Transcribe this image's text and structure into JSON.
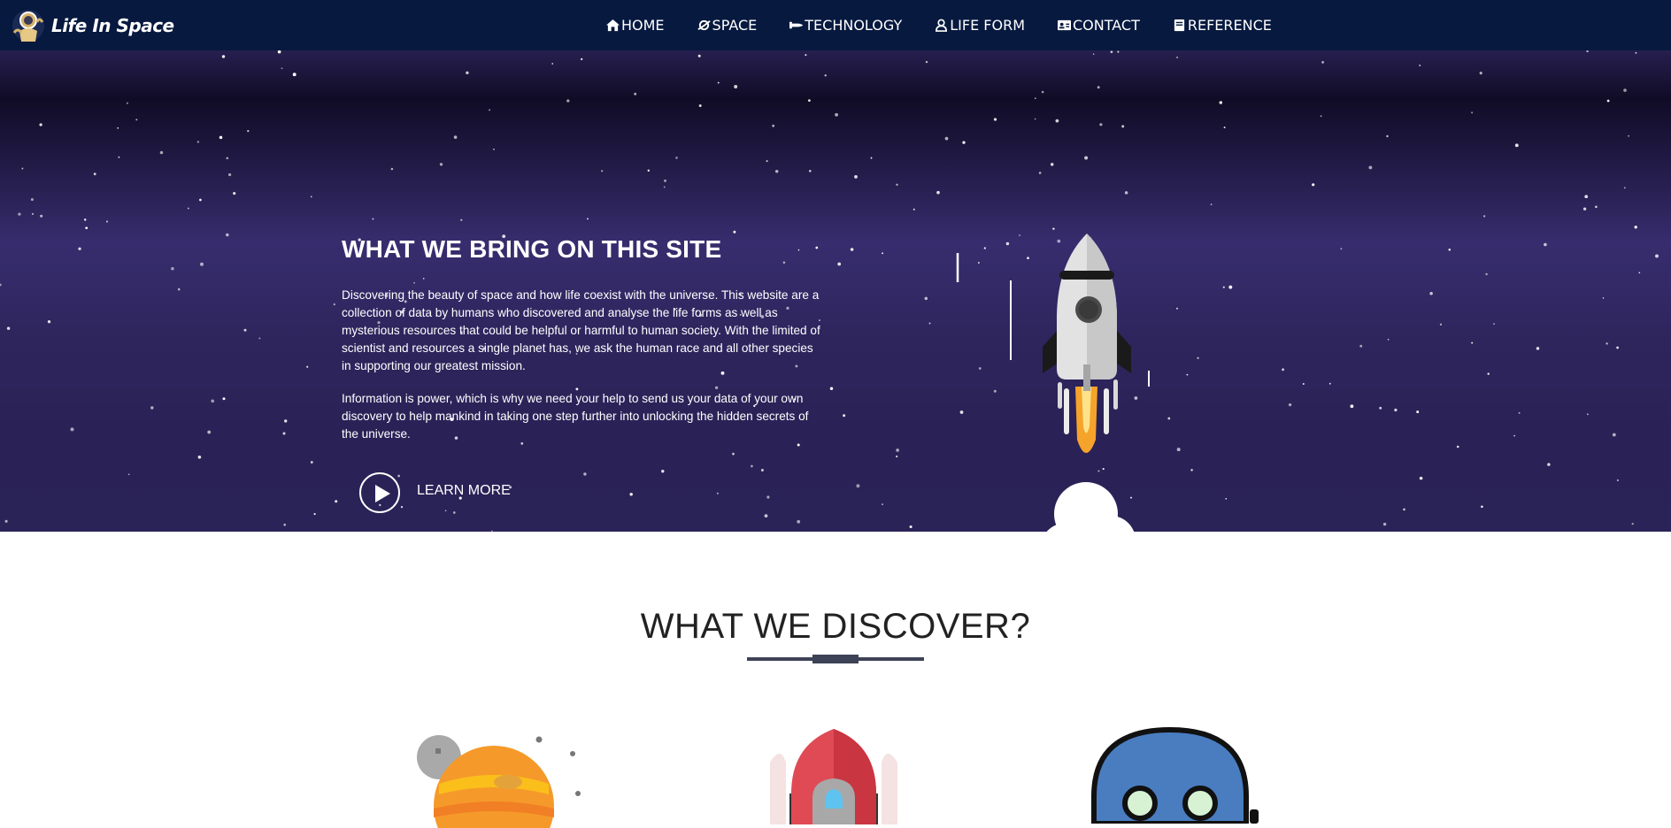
{
  "brand": {
    "name": "Life In Space"
  },
  "nav": {
    "items": [
      {
        "label": "HOME",
        "icon": "home-icon"
      },
      {
        "label": "SPACE",
        "icon": "planet-icon"
      },
      {
        "label": "TECHNOLOGY",
        "icon": "space-shuttle-icon"
      },
      {
        "label": "LIFE FORM",
        "icon": "user-icon"
      },
      {
        "label": "CONTACT",
        "icon": "id-card-icon"
      },
      {
        "label": "REFERENCE",
        "icon": "book-icon"
      }
    ]
  },
  "hero": {
    "title": "WHAT WE BRING ON THIS SITE",
    "paragraph1": "Discovering the beauty of space and how life coexist with the universe. This website are a collection of data by humans who discovered and analyse the life forms as well as mysterious resources that could be helpful or harmful to human society. With the limited of scientist and resources a single planet has, we ask the human race and all other species in supporting our greatest mission.",
    "paragraph2": "Information is power, which is why we need your help to send us your data of your own discovery to help mankind in taking one step further into unlocking the hidden secrets of the universe.",
    "cta_label": "LEARN MORE"
  },
  "discover": {
    "title": "WHAT WE DISCOVER?",
    "items": [
      {
        "icon": "planet-icon"
      },
      {
        "icon": "space-shuttle-icon"
      },
      {
        "icon": "alien-icon"
      }
    ]
  },
  "colors": {
    "navbar_bg": "#07193f",
    "hero_bg": "#2a2256",
    "accent": "#3e4256"
  }
}
